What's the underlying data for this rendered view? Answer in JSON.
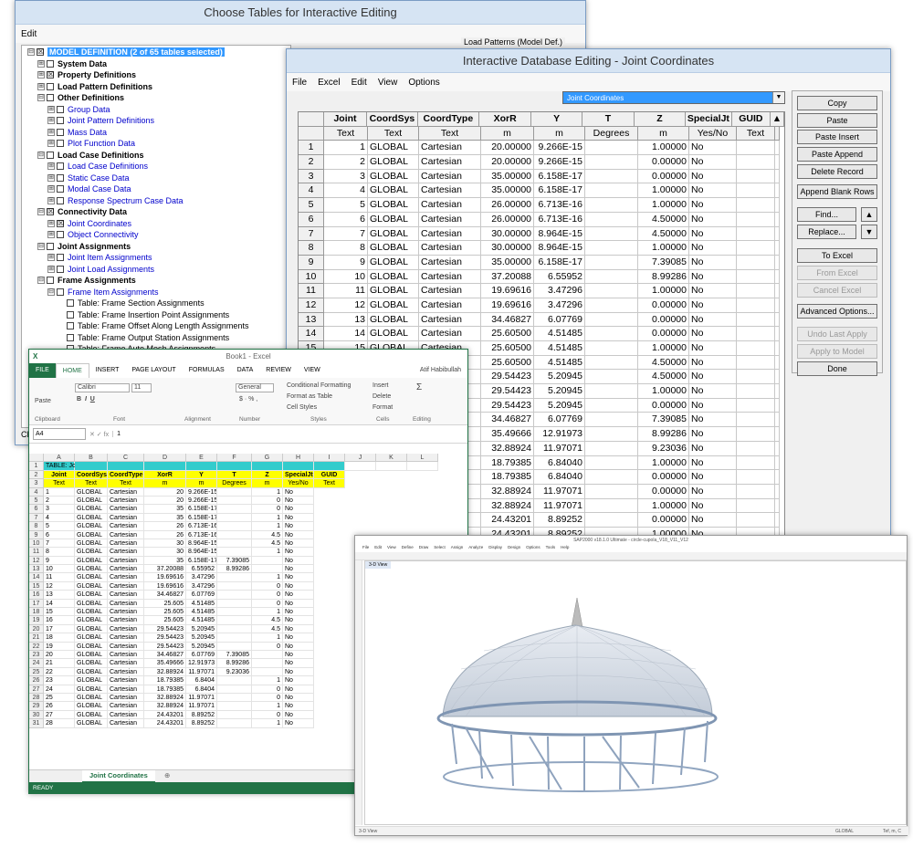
{
  "choose": {
    "title": "Choose Tables for Interactive Editing",
    "menu_edit": "Edit",
    "load_patterns_label": "Load Patterns (Model Def.)",
    "tree": [
      {
        "indent": 0,
        "exp": "⊟",
        "cb": "☒",
        "text": "MODEL DEFINITION  (2 of 65 tables selected)",
        "style": "sel"
      },
      {
        "indent": 1,
        "exp": "⊞",
        "cb": "",
        "text": "System Data",
        "style": "bold"
      },
      {
        "indent": 1,
        "exp": "⊞",
        "cb": "☒",
        "text": "Property Definitions",
        "style": "bold"
      },
      {
        "indent": 1,
        "exp": "⊞",
        "cb": "",
        "text": "Load Pattern Definitions",
        "style": "bold"
      },
      {
        "indent": 1,
        "exp": "⊟",
        "cb": "",
        "text": "Other Definitions",
        "style": "bold"
      },
      {
        "indent": 2,
        "exp": "⊞",
        "cb": "",
        "text": "Group Data",
        "style": "blue"
      },
      {
        "indent": 2,
        "exp": "⊞",
        "cb": "",
        "text": "Joint Pattern Definitions",
        "style": "blue"
      },
      {
        "indent": 2,
        "exp": "⊞",
        "cb": "",
        "text": "Mass Data",
        "style": "blue"
      },
      {
        "indent": 2,
        "exp": "⊞",
        "cb": "",
        "text": "Plot Function Data",
        "style": "blue"
      },
      {
        "indent": 1,
        "exp": "⊟",
        "cb": "",
        "text": "Load Case Definitions",
        "style": "bold"
      },
      {
        "indent": 2,
        "exp": "⊞",
        "cb": "",
        "text": "Load Case Definitions",
        "style": "blue"
      },
      {
        "indent": 2,
        "exp": "⊞",
        "cb": "",
        "text": "Static Case Data",
        "style": "blue"
      },
      {
        "indent": 2,
        "exp": "⊞",
        "cb": "",
        "text": "Modal Case Data",
        "style": "blue"
      },
      {
        "indent": 2,
        "exp": "⊞",
        "cb": "",
        "text": "Response Spectrum Case Data",
        "style": "blue"
      },
      {
        "indent": 1,
        "exp": "⊟",
        "cb": "☒",
        "text": "Connectivity Data",
        "style": "bold"
      },
      {
        "indent": 2,
        "exp": "⊞",
        "cb": "☒",
        "text": "Joint Coordinates",
        "style": "blue"
      },
      {
        "indent": 2,
        "exp": "⊞",
        "cb": "",
        "text": "Object Connectivity",
        "style": "blue"
      },
      {
        "indent": 1,
        "exp": "⊟",
        "cb": "",
        "text": "Joint Assignments",
        "style": "bold"
      },
      {
        "indent": 2,
        "exp": "⊞",
        "cb": "",
        "text": "Joint Item Assignments",
        "style": "blue"
      },
      {
        "indent": 2,
        "exp": "⊞",
        "cb": "",
        "text": "Joint Load Assignments",
        "style": "blue"
      },
      {
        "indent": 1,
        "exp": "⊟",
        "cb": "",
        "text": "Frame Assignments",
        "style": "bold"
      },
      {
        "indent": 2,
        "exp": "⊟",
        "cb": "",
        "text": "Frame Item Assignments",
        "style": "blue"
      },
      {
        "indent": 3,
        "exp": "",
        "cb": "",
        "text": "Table:  Frame Section Assignments",
        "style": ""
      },
      {
        "indent": 3,
        "exp": "",
        "cb": "",
        "text": "Table:  Frame Insertion Point Assignments",
        "style": ""
      },
      {
        "indent": 3,
        "exp": "",
        "cb": "",
        "text": "Table:  Frame Offset Along Length Assignments",
        "style": ""
      },
      {
        "indent": 3,
        "exp": "",
        "cb": "",
        "text": "Table:  Frame Output Station Assignments",
        "style": ""
      },
      {
        "indent": 3,
        "exp": "",
        "cb": "",
        "text": "Table:  Frame Auto Mesh Assignments",
        "style": ""
      }
    ],
    "clip_label": "Cli"
  },
  "joint": {
    "title": "Interactive Database Editing - Joint Coordinates",
    "menu": [
      "File",
      "Excel",
      "Edit",
      "View",
      "Options"
    ],
    "table_select": "Joint Coordinates",
    "headers": [
      "Joint",
      "CoordSys",
      "CoordType",
      "XorR",
      "Y",
      "T",
      "Z",
      "SpecialJt",
      "GUID"
    ],
    "units": [
      "Text",
      "Text",
      "Text",
      "m",
      "m",
      "Degrees",
      "m",
      "Yes/No",
      "Text"
    ],
    "rows": [
      [
        "1",
        "GLOBAL",
        "Cartesian",
        "20.00000",
        "9.266E-15",
        "",
        "1.00000",
        "No",
        ""
      ],
      [
        "2",
        "GLOBAL",
        "Cartesian",
        "20.00000",
        "9.266E-15",
        "",
        "0.00000",
        "No",
        ""
      ],
      [
        "3",
        "GLOBAL",
        "Cartesian",
        "35.00000",
        "6.158E-17",
        "",
        "0.00000",
        "No",
        ""
      ],
      [
        "4",
        "GLOBAL",
        "Cartesian",
        "35.00000",
        "6.158E-17",
        "",
        "1.00000",
        "No",
        ""
      ],
      [
        "5",
        "GLOBAL",
        "Cartesian",
        "26.00000",
        "6.713E-16",
        "",
        "1.00000",
        "No",
        ""
      ],
      [
        "6",
        "GLOBAL",
        "Cartesian",
        "26.00000",
        "6.713E-16",
        "",
        "4.50000",
        "No",
        ""
      ],
      [
        "7",
        "GLOBAL",
        "Cartesian",
        "30.00000",
        "8.964E-15",
        "",
        "4.50000",
        "No",
        ""
      ],
      [
        "8",
        "GLOBAL",
        "Cartesian",
        "30.00000",
        "8.964E-15",
        "",
        "1.00000",
        "No",
        ""
      ],
      [
        "9",
        "GLOBAL",
        "Cartesian",
        "35.00000",
        "6.158E-17",
        "",
        "7.39085",
        "No",
        ""
      ],
      [
        "10",
        "GLOBAL",
        "Cartesian",
        "37.20088",
        "6.55952",
        "",
        "8.99286",
        "No",
        ""
      ],
      [
        "11",
        "GLOBAL",
        "Cartesian",
        "19.69616",
        "3.47296",
        "",
        "1.00000",
        "No",
        ""
      ],
      [
        "12",
        "GLOBAL",
        "Cartesian",
        "19.69616",
        "3.47296",
        "",
        "0.00000",
        "No",
        ""
      ],
      [
        "13",
        "GLOBAL",
        "Cartesian",
        "34.46827",
        "6.07769",
        "",
        "0.00000",
        "No",
        ""
      ],
      [
        "14",
        "GLOBAL",
        "Cartesian",
        "25.60500",
        "4.51485",
        "",
        "0.00000",
        "No",
        ""
      ],
      [
        "15",
        "GLOBAL",
        "Cartesian",
        "25.60500",
        "4.51485",
        "",
        "1.00000",
        "No",
        ""
      ],
      [
        "16",
        "",
        "",
        "25.60500",
        "4.51485",
        "",
        "4.50000",
        "No",
        ""
      ],
      [
        "17",
        "",
        "",
        "29.54423",
        "5.20945",
        "",
        "4.50000",
        "No",
        ""
      ],
      [
        "18",
        "",
        "",
        "29.54423",
        "5.20945",
        "",
        "1.00000",
        "No",
        ""
      ],
      [
        "19",
        "",
        "",
        "29.54423",
        "5.20945",
        "",
        "0.00000",
        "No",
        ""
      ],
      [
        "20",
        "",
        "",
        "34.46827",
        "6.07769",
        "",
        "7.39085",
        "No",
        ""
      ],
      [
        "21",
        "",
        "",
        "35.49666",
        "12.91973",
        "",
        "8.99286",
        "No",
        ""
      ],
      [
        "22",
        "",
        "",
        "32.88924",
        "11.97071",
        "",
        "9.23036",
        "No",
        ""
      ],
      [
        "23",
        "",
        "",
        "18.79385",
        "6.84040",
        "",
        "1.00000",
        "No",
        ""
      ],
      [
        "24",
        "",
        "",
        "18.79385",
        "6.84040",
        "",
        "0.00000",
        "No",
        ""
      ],
      [
        "25",
        "",
        "",
        "32.88924",
        "11.97071",
        "",
        "0.00000",
        "No",
        ""
      ],
      [
        "26",
        "",
        "",
        "32.88924",
        "11.97071",
        "",
        "1.00000",
        "No",
        ""
      ],
      [
        "27",
        "",
        "",
        "24.43201",
        "8.89252",
        "",
        "0.00000",
        "No",
        ""
      ],
      [
        "28",
        "",
        "",
        "24.43201",
        "8.89252",
        "",
        "1.00000",
        "No",
        ""
      ]
    ],
    "buttons": {
      "copy": "Copy",
      "paste": "Paste",
      "paste_insert": "Paste Insert",
      "paste_append": "Paste Append",
      "delete_record": "Delete Record",
      "append_blank": "Append Blank Rows",
      "find": "Find...",
      "replace": "Replace...",
      "to_excel": "To Excel",
      "from_excel": "From Excel",
      "cancel_excel": "Cancel Excel",
      "advanced": "Advanced Options...",
      "undo": "Undo Last Apply",
      "apply": "Apply to Model",
      "done": "Done"
    }
  },
  "excel": {
    "title": "Book1 - Excel",
    "user": "Atif Habibullah",
    "tabs": [
      "FILE",
      "HOME",
      "INSERT",
      "PAGE LAYOUT",
      "FORMULAS",
      "DATA",
      "REVIEW",
      "VIEW"
    ],
    "font_name": "Calibri",
    "font_size": "11",
    "number_format": "General",
    "ribbon_groups": [
      "Clipboard",
      "Font",
      "Alignment",
      "Number",
      "Styles",
      "Cells",
      "Editing"
    ],
    "ribbon_items": {
      "paste": "Paste",
      "cond_fmt": "Conditional Formatting",
      "fmt_table": "Format as Table",
      "cell_styles": "Cell Styles",
      "insert": "Insert",
      "delete": "Delete",
      "format": "Format"
    },
    "namebox": "A4",
    "formula": "1",
    "col_letters": [
      "A",
      "B",
      "C",
      "D",
      "E",
      "F",
      "G",
      "H",
      "I",
      "J",
      "K",
      "L"
    ],
    "table_title": "TABLE:  Joint Coordinates",
    "headers": [
      "Joint",
      "CoordSys",
      "CoordType",
      "XorR",
      "Y",
      "T",
      "Z",
      "SpecialJt",
      "GUID"
    ],
    "units": [
      "Text",
      "Text",
      "Text",
      "m",
      "m",
      "Degrees",
      "m",
      "Yes/No",
      "Text"
    ],
    "rows": [
      [
        "1",
        "GLOBAL",
        "Cartesian",
        "20",
        "9.266E-15",
        "",
        "1",
        "No"
      ],
      [
        "2",
        "GLOBAL",
        "Cartesian",
        "20",
        "9.266E-15",
        "",
        "0",
        "No"
      ],
      [
        "3",
        "GLOBAL",
        "Cartesian",
        "35",
        "6.158E-17",
        "",
        "0",
        "No"
      ],
      [
        "4",
        "GLOBAL",
        "Cartesian",
        "35",
        "6.158E-17",
        "",
        "1",
        "No"
      ],
      [
        "5",
        "GLOBAL",
        "Cartesian",
        "26",
        "6.713E-16",
        "",
        "1",
        "No"
      ],
      [
        "6",
        "GLOBAL",
        "Cartesian",
        "26",
        "6.713E-16",
        "",
        "4.5",
        "No"
      ],
      [
        "7",
        "GLOBAL",
        "Cartesian",
        "30",
        "8.964E-15",
        "",
        "4.5",
        "No"
      ],
      [
        "8",
        "GLOBAL",
        "Cartesian",
        "30",
        "8.964E-15",
        "",
        "1",
        "No"
      ],
      [
        "9",
        "GLOBAL",
        "Cartesian",
        "35",
        "6.158E-17",
        "7.39085",
        "",
        "No"
      ],
      [
        "10",
        "GLOBAL",
        "Cartesian",
        "37.20088",
        "6.55952",
        "8.99286",
        "",
        "No"
      ],
      [
        "11",
        "GLOBAL",
        "Cartesian",
        "19.69616",
        "3.47296",
        "",
        "1",
        "No"
      ],
      [
        "12",
        "GLOBAL",
        "Cartesian",
        "19.69616",
        "3.47296",
        "",
        "0",
        "No"
      ],
      [
        "13",
        "GLOBAL",
        "Cartesian",
        "34.46827",
        "6.07769",
        "",
        "0",
        "No"
      ],
      [
        "14",
        "GLOBAL",
        "Cartesian",
        "25.605",
        "4.51485",
        "",
        "0",
        "No"
      ],
      [
        "15",
        "GLOBAL",
        "Cartesian",
        "25.605",
        "4.51485",
        "",
        "1",
        "No"
      ],
      [
        "16",
        "GLOBAL",
        "Cartesian",
        "25.605",
        "4.51485",
        "",
        "4.5",
        "No"
      ],
      [
        "17",
        "GLOBAL",
        "Cartesian",
        "29.54423",
        "5.20945",
        "",
        "4.5",
        "No"
      ],
      [
        "18",
        "GLOBAL",
        "Cartesian",
        "29.54423",
        "5.20945",
        "",
        "1",
        "No"
      ],
      [
        "19",
        "GLOBAL",
        "Cartesian",
        "29.54423",
        "5.20945",
        "",
        "0",
        "No"
      ],
      [
        "20",
        "GLOBAL",
        "Cartesian",
        "34.46827",
        "6.07769",
        "7.39085",
        "",
        "No"
      ],
      [
        "21",
        "GLOBAL",
        "Cartesian",
        "35.49666",
        "12.91973",
        "8.99286",
        "",
        "No"
      ],
      [
        "22",
        "GLOBAL",
        "Cartesian",
        "32.88924",
        "11.97071",
        "9.23036",
        "",
        "No"
      ],
      [
        "23",
        "GLOBAL",
        "Cartesian",
        "18.79385",
        "6.8404",
        "",
        "1",
        "No"
      ],
      [
        "24",
        "GLOBAL",
        "Cartesian",
        "18.79385",
        "6.8404",
        "",
        "0",
        "No"
      ],
      [
        "25",
        "GLOBAL",
        "Cartesian",
        "32.88924",
        "11.97071",
        "",
        "0",
        "No"
      ],
      [
        "26",
        "GLOBAL",
        "Cartesian",
        "32.88924",
        "11.97071",
        "",
        "1",
        "No"
      ],
      [
        "27",
        "GLOBAL",
        "Cartesian",
        "24.43201",
        "8.89252",
        "",
        "0",
        "No"
      ],
      [
        "28",
        "GLOBAL",
        "Cartesian",
        "24.43201",
        "8.89252",
        "",
        "1",
        "No"
      ]
    ],
    "sheet_tab": "Joint Coordinates",
    "status": "READY"
  },
  "sap": {
    "title": "SAP2000 v18.1.0 Ultimate - circle-cupola_V18_V11_V12",
    "menu": [
      "File",
      "Edit",
      "View",
      "Define",
      "Draw",
      "Select",
      "Assign",
      "Analyze",
      "Display",
      "Design",
      "Options",
      "Tools",
      "Help"
    ],
    "view_tab": "3-D View",
    "status": "3-D View",
    "units": "GLOBAL",
    "units2": "Tef, m, C"
  },
  "colors": {
    "excel_green": "#217346",
    "selection_blue": "#3399ff",
    "table_title": "#33cccc",
    "header_yellow": "#ffff00"
  }
}
